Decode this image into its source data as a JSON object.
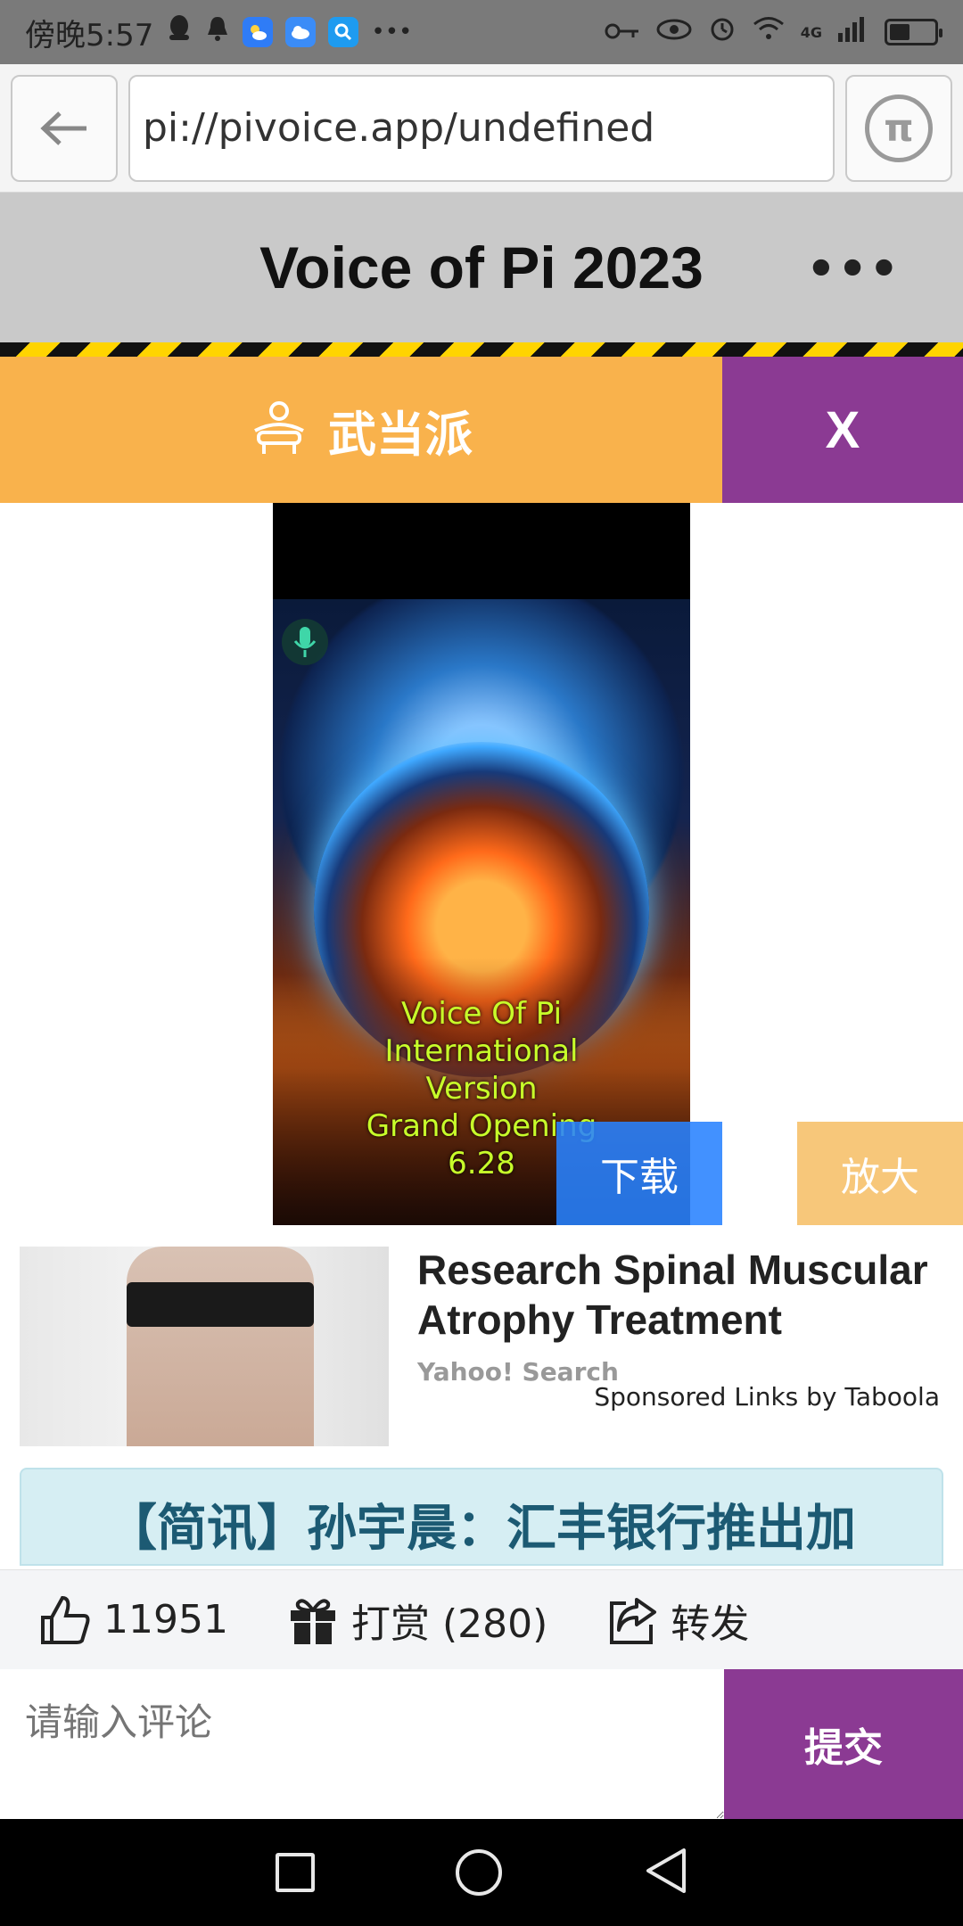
{
  "status_bar": {
    "time": "傍晚5:57",
    "network": "4G",
    "battery_level": 0.45
  },
  "browser": {
    "url": "pi://pivoice.app/undefined"
  },
  "app": {
    "title": "Voice of Pi 2023",
    "menu_label": "•••"
  },
  "channel": {
    "name": "武当派",
    "close_label": "X"
  },
  "video": {
    "overlay_lines": [
      "Voice Of Pi",
      "International",
      "Version",
      "Grand Opening",
      "6.28"
    ],
    "download_label": "下载",
    "zoom_label": "放大"
  },
  "sponsored": {
    "title": "Research Spinal Muscular Atrophy Treatment",
    "source": "Yahoo! Search",
    "sponsor_text": "Sponsored Links by Taboola"
  },
  "news": {
    "title": "【简讯】孙宇晨：汇丰银行推出加"
  },
  "actions": {
    "likes": "11951",
    "reward_label": "打赏 (280)",
    "share_label": "转发"
  },
  "comment": {
    "placeholder": "请输入评论",
    "submit_label": "提交"
  },
  "colors": {
    "accent_purple": "#8b3a93",
    "channel_orange": "#f9b24c",
    "download_blue": "#2882ff",
    "zoom_orange": "#f7c77a",
    "news_bg": "#d6eef3"
  }
}
